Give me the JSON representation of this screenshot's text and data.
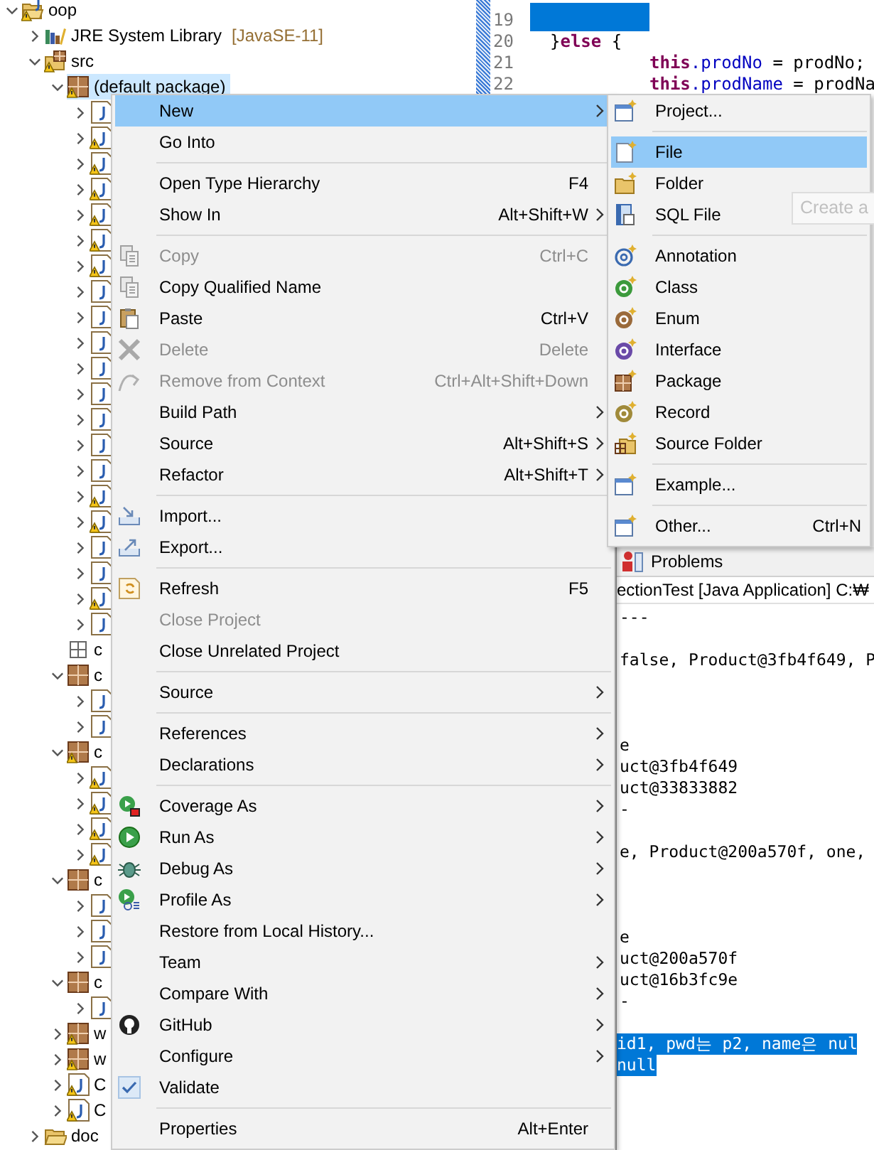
{
  "tree": [
    {
      "label": "oop",
      "kind": "project",
      "warning": true,
      "expanded": true,
      "selected": false,
      "children": [
        {
          "label": "JRE System Library",
          "suffix": "[JavaSE-11]",
          "kind": "library",
          "warning": false,
          "expanded": false,
          "selected": false
        },
        {
          "label": "src",
          "kind": "source-folder",
          "warning": true,
          "expanded": true,
          "selected": false,
          "children": [
            {
              "label": "(default package)",
              "kind": "package",
              "warning": true,
              "expanded": true,
              "selected": true,
              "children": [
                {
                  "kind": "file",
                  "warning": false,
                  "expanded": false,
                  "selected": false
                },
                {
                  "kind": "file",
                  "warning": true,
                  "expanded": false,
                  "selected": false
                },
                {
                  "kind": "file",
                  "warning": true,
                  "expanded": false,
                  "selected": false
                },
                {
                  "kind": "file",
                  "warning": true,
                  "expanded": false,
                  "selected": false
                },
                {
                  "kind": "file",
                  "warning": true,
                  "expanded": false,
                  "selected": false
                },
                {
                  "kind": "file",
                  "warning": true,
                  "expanded": false,
                  "selected": false
                },
                {
                  "kind": "file",
                  "warning": true,
                  "expanded": false,
                  "selected": false
                },
                {
                  "kind": "file",
                  "warning": false,
                  "expanded": false,
                  "selected": false
                },
                {
                  "kind": "file",
                  "warning": false,
                  "expanded": false,
                  "selected": false
                },
                {
                  "kind": "file",
                  "warning": false,
                  "expanded": false,
                  "selected": false
                },
                {
                  "kind": "file",
                  "warning": false,
                  "expanded": false,
                  "selected": false
                },
                {
                  "kind": "file",
                  "warning": false,
                  "expanded": false,
                  "selected": false
                },
                {
                  "kind": "file",
                  "warning": false,
                  "expanded": false,
                  "selected": false
                },
                {
                  "kind": "file",
                  "warning": false,
                  "expanded": false,
                  "selected": false
                },
                {
                  "kind": "file",
                  "warning": false,
                  "expanded": false,
                  "selected": false
                },
                {
                  "kind": "file",
                  "warning": true,
                  "expanded": false,
                  "selected": false
                },
                {
                  "kind": "file",
                  "warning": true,
                  "expanded": false,
                  "selected": false
                },
                {
                  "kind": "file",
                  "warning": false,
                  "expanded": false,
                  "selected": false
                },
                {
                  "kind": "file",
                  "warning": false,
                  "expanded": false,
                  "selected": false
                },
                {
                  "kind": "file",
                  "warning": true,
                  "expanded": false,
                  "selected": false
                },
                {
                  "kind": "file",
                  "warning": false,
                  "expanded": false,
                  "selected": false
                }
              ]
            },
            {
              "label": "c",
              "kind": "empty-package",
              "warning": false,
              "selected": false
            },
            {
              "label": "c",
              "kind": "package",
              "warning": false,
              "expanded": true,
              "selected": false,
              "children": [
                {
                  "kind": "file",
                  "warning": false,
                  "expanded": false,
                  "selected": false
                },
                {
                  "kind": "file",
                  "warning": false,
                  "expanded": false,
                  "selected": false
                }
              ]
            },
            {
              "label": "c",
              "kind": "package",
              "warning": true,
              "expanded": true,
              "selected": false,
              "children": [
                {
                  "kind": "file",
                  "warning": true,
                  "expanded": false,
                  "selected": false
                },
                {
                  "kind": "file",
                  "warning": true,
                  "expanded": false,
                  "selected": false
                },
                {
                  "kind": "file",
                  "warning": true,
                  "expanded": false,
                  "selected": false
                },
                {
                  "kind": "file",
                  "warning": true,
                  "expanded": false,
                  "selected": false
                }
              ]
            },
            {
              "label": "c",
              "kind": "package",
              "warning": false,
              "expanded": true,
              "selected": false,
              "children": [
                {
                  "kind": "file",
                  "warning": false,
                  "expanded": false,
                  "selected": false
                },
                {
                  "kind": "file",
                  "warning": false,
                  "expanded": false,
                  "selected": false
                },
                {
                  "kind": "file",
                  "warning": false,
                  "expanded": false,
                  "selected": false
                }
              ]
            },
            {
              "label": "c",
              "kind": "package",
              "warning": false,
              "expanded": true,
              "selected": false,
              "children": [
                {
                  "kind": "file",
                  "warning": false,
                  "expanded": false,
                  "selected": false
                }
              ]
            },
            {
              "label": "w",
              "kind": "package",
              "warning": true,
              "expanded": false,
              "selected": false
            },
            {
              "label": "w",
              "kind": "package",
              "warning": true,
              "expanded": false,
              "selected": false
            },
            {
              "label": "C",
              "kind": "file",
              "warning": true,
              "expanded": false,
              "selected": false
            },
            {
              "label": "C",
              "kind": "file",
              "warning": true,
              "expanded": false,
              "selected": false
            }
          ]
        },
        {
          "label": "doc",
          "kind": "folder",
          "warning": false,
          "expanded": false,
          "selected": false
        }
      ]
    }
  ],
  "editor": {
    "lines": [
      {
        "number": "19",
        "selected": true
      },
      {
        "number": "20",
        "selected": false,
        "segments": [
          {
            "kind": "tab"
          },
          {
            "kind": "plain",
            "text": "}"
          },
          {
            "kind": "keyword",
            "text": "else"
          },
          {
            "kind": "plain",
            "text": " {"
          }
        ]
      },
      {
        "number": "21",
        "selected": false,
        "segments": [
          {
            "kind": "tab"
          },
          {
            "kind": "tab"
          },
          {
            "kind": "tab"
          },
          {
            "kind": "tab"
          },
          {
            "kind": "tab"
          },
          {
            "kind": "tab"
          },
          {
            "kind": "keyword",
            "text": "this"
          },
          {
            "kind": "field",
            "text": ".prodNo"
          },
          {
            "kind": "plain",
            "text": " = prodNo;"
          }
        ]
      },
      {
        "number": "22",
        "selected": false,
        "segments": [
          {
            "kind": "tab"
          },
          {
            "kind": "tab"
          },
          {
            "kind": "tab"
          },
          {
            "kind": "tab"
          },
          {
            "kind": "tab"
          },
          {
            "kind": "tab"
          },
          {
            "kind": "keyword",
            "text": "this"
          },
          {
            "kind": "field",
            "text": ".prodName"
          },
          {
            "kind": "plain",
            "text": " = prodNa"
          }
        ]
      }
    ]
  },
  "console": {
    "tab": "Problems",
    "header": "ectionTest [Java Application] C:₩",
    "lines": [
      {
        "kind": "text",
        "text": "---",
        "selected": false
      },
      {
        "kind": "blank"
      },
      {
        "kind": "text",
        "text": "false, Product@3fb4f649, P",
        "selected": false
      },
      {
        "kind": "blank"
      },
      {
        "kind": "blank"
      },
      {
        "kind": "blank"
      },
      {
        "kind": "text",
        "text": "e",
        "selected": false
      },
      {
        "kind": "text",
        "text": "uct@3fb4f649",
        "selected": false
      },
      {
        "kind": "text",
        "text": "uct@33833882",
        "selected": false
      },
      {
        "kind": "text",
        "text": "-",
        "selected": false
      },
      {
        "kind": "blank"
      },
      {
        "kind": "text",
        "text": "e, Product@200a570f, one,",
        "selected": false
      },
      {
        "kind": "blank"
      },
      {
        "kind": "blank"
      },
      {
        "kind": "blank"
      },
      {
        "kind": "text",
        "text": "e",
        "selected": false
      },
      {
        "kind": "text",
        "text": "uct@200a570f",
        "selected": false
      },
      {
        "kind": "text",
        "text": "uct@16b3fc9e",
        "selected": false
      },
      {
        "kind": "text",
        "text": "-",
        "selected": false
      },
      {
        "kind": "blank"
      },
      {
        "kind": "text",
        "text": "id1, pwd는 p2, name은 nul",
        "selected": true
      },
      {
        "kind": "text",
        "text": "null",
        "selected": true
      }
    ]
  },
  "menu": [
    {
      "kind": "item",
      "label": "New",
      "selected": true,
      "disabled": false,
      "checked": false,
      "submenu": true
    },
    {
      "kind": "item",
      "label": "Go Into",
      "selected": false,
      "disabled": false,
      "checked": false,
      "submenu": false
    },
    {
      "kind": "separator"
    },
    {
      "kind": "item",
      "label": "Open Type Hierarchy",
      "shortcut": "F4",
      "selected": false,
      "disabled": false,
      "checked": false,
      "submenu": false
    },
    {
      "kind": "item",
      "label": "Show In",
      "shortcut": "Alt+Shift+W",
      "selected": false,
      "disabled": false,
      "checked": false,
      "submenu": true
    },
    {
      "kind": "separator"
    },
    {
      "kind": "item",
      "label": "Copy",
      "shortcut": "Ctrl+C",
      "selected": false,
      "disabled": true,
      "checked": false,
      "submenu": false
    },
    {
      "kind": "item",
      "label": "Copy Qualified Name",
      "selected": false,
      "disabled": false,
      "checked": false,
      "submenu": false
    },
    {
      "kind": "item",
      "label": "Paste",
      "shortcut": "Ctrl+V",
      "selected": false,
      "disabled": false,
      "checked": false,
      "submenu": false
    },
    {
      "kind": "item",
      "label": "Delete",
      "shortcut": "Delete",
      "selected": false,
      "disabled": true,
      "checked": false,
      "submenu": false
    },
    {
      "kind": "item",
      "label": "Remove from Context",
      "shortcut": "Ctrl+Alt+Shift+Down",
      "selected": false,
      "disabled": true,
      "checked": false,
      "submenu": false
    },
    {
      "kind": "item",
      "label": "Build Path",
      "selected": false,
      "disabled": false,
      "checked": false,
      "submenu": true
    },
    {
      "kind": "item",
      "label": "Source",
      "shortcut": "Alt+Shift+S",
      "selected": false,
      "disabled": false,
      "checked": false,
      "submenu": true
    },
    {
      "kind": "item",
      "label": "Refactor",
      "shortcut": "Alt+Shift+T",
      "selected": false,
      "disabled": false,
      "checked": false,
      "submenu": true
    },
    {
      "kind": "separator"
    },
    {
      "kind": "item",
      "label": "Import...",
      "selected": false,
      "disabled": false,
      "checked": false,
      "submenu": false
    },
    {
      "kind": "item",
      "label": "Export...",
      "selected": false,
      "disabled": false,
      "checked": false,
      "submenu": false
    },
    {
      "kind": "separator"
    },
    {
      "kind": "item",
      "label": "Refresh",
      "shortcut": "F5",
      "selected": false,
      "disabled": false,
      "checked": false,
      "submenu": false
    },
    {
      "kind": "item",
      "label": "Close Project",
      "selected": false,
      "disabled": true,
      "checked": false,
      "submenu": false
    },
    {
      "kind": "item",
      "label": "Close Unrelated Project",
      "selected": false,
      "disabled": false,
      "checked": false,
      "submenu": false
    },
    {
      "kind": "separator"
    },
    {
      "kind": "item",
      "label": "Source",
      "selected": false,
      "disabled": false,
      "checked": false,
      "submenu": true
    },
    {
      "kind": "separator"
    },
    {
      "kind": "item",
      "label": "References",
      "selected": false,
      "disabled": false,
      "checked": false,
      "submenu": true
    },
    {
      "kind": "item",
      "label": "Declarations",
      "selected": false,
      "disabled": false,
      "checked": false,
      "submenu": true
    },
    {
      "kind": "separator"
    },
    {
      "kind": "item",
      "label": "Coverage As",
      "selected": false,
      "disabled": false,
      "checked": false,
      "submenu": true
    },
    {
      "kind": "item",
      "label": "Run As",
      "selected": false,
      "disabled": false,
      "checked": false,
      "submenu": true
    },
    {
      "kind": "item",
      "label": "Debug As",
      "selected": false,
      "disabled": false,
      "checked": false,
      "submenu": true
    },
    {
      "kind": "item",
      "label": "Profile As",
      "selected": false,
      "disabled": false,
      "checked": false,
      "submenu": true
    },
    {
      "kind": "item",
      "label": "Restore from Local History...",
      "selected": false,
      "disabled": false,
      "checked": false,
      "submenu": false
    },
    {
      "kind": "item",
      "label": "Team",
      "selected": false,
      "disabled": false,
      "checked": false,
      "submenu": true
    },
    {
      "kind": "item",
      "label": "Compare With",
      "selected": false,
      "disabled": false,
      "checked": false,
      "submenu": true
    },
    {
      "kind": "item",
      "label": "GitHub",
      "selected": false,
      "disabled": false,
      "checked": false,
      "submenu": true
    },
    {
      "kind": "item",
      "label": "Configure",
      "selected": false,
      "disabled": false,
      "checked": false,
      "submenu": true
    },
    {
      "kind": "item",
      "label": "Validate",
      "selected": false,
      "disabled": false,
      "checked": true,
      "submenu": false
    },
    {
      "kind": "separator"
    },
    {
      "kind": "item",
      "label": "Properties",
      "shortcut": "Alt+Enter",
      "selected": false,
      "disabled": false,
      "checked": false,
      "submenu": false
    }
  ],
  "submenu": [
    {
      "kind": "item",
      "label": "Project...",
      "selected": false
    },
    {
      "kind": "separator"
    },
    {
      "kind": "item",
      "label": "File",
      "selected": true
    },
    {
      "kind": "item",
      "label": "Folder",
      "selected": false
    },
    {
      "kind": "item",
      "label": "SQL File",
      "selected": false
    },
    {
      "kind": "separator"
    },
    {
      "kind": "item",
      "label": "Annotation",
      "selected": false
    },
    {
      "kind": "item",
      "label": "Class",
      "selected": false
    },
    {
      "kind": "item",
      "label": "Enum",
      "selected": false
    },
    {
      "kind": "item",
      "label": "Interface",
      "selected": false
    },
    {
      "kind": "item",
      "label": "Package",
      "selected": false
    },
    {
      "kind": "item",
      "label": "Record",
      "selected": false
    },
    {
      "kind": "item",
      "label": "Source Folder",
      "selected": false
    },
    {
      "kind": "separator"
    },
    {
      "kind": "item",
      "label": "Example...",
      "selected": false
    },
    {
      "kind": "separator"
    },
    {
      "kind": "item",
      "label": "Other...",
      "shortcut": "Ctrl+N",
      "selected": false
    }
  ],
  "tooltip": {
    "text": "Create a"
  }
}
